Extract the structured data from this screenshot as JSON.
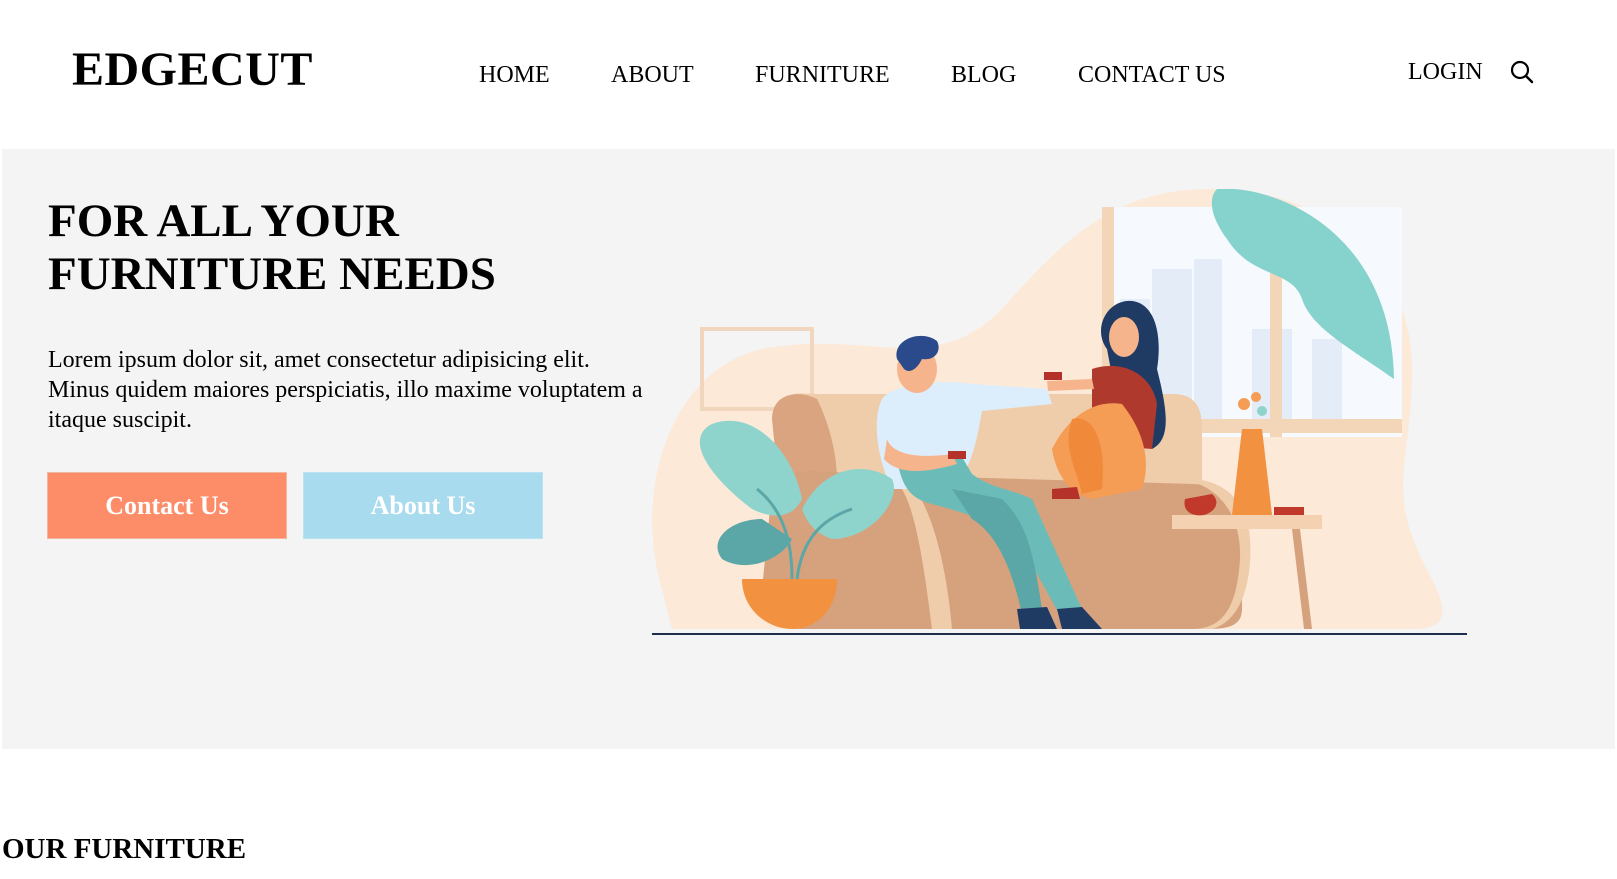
{
  "brand": "EDGECUT",
  "nav": {
    "items": [
      {
        "label": "HOME"
      },
      {
        "label": "ABOUT"
      },
      {
        "label": "FURNITURE"
      },
      {
        "label": "BLOG"
      },
      {
        "label": "CONTACT US"
      }
    ],
    "login_label": "LOGIN",
    "search_icon": "search-icon"
  },
  "hero": {
    "title_line1": "FOR ALL YOUR",
    "title_line2": "FURNITURE NEEDS",
    "description": "Lorem ipsum dolor sit, amet consectetur adipisicing elit. Minus quidem maiores perspiciatis, illo maxime voluptatem a itaque suscipit.",
    "contact_button": "Contact Us",
    "about_button": "About Us",
    "illustration": "couple-on-sofa-illustration"
  },
  "section": {
    "title": "OUR FURNITURE"
  },
  "colors": {
    "contact_button": "#fd8c69",
    "about_button": "#a9dbee",
    "hero_background": "#f4f4f4"
  }
}
